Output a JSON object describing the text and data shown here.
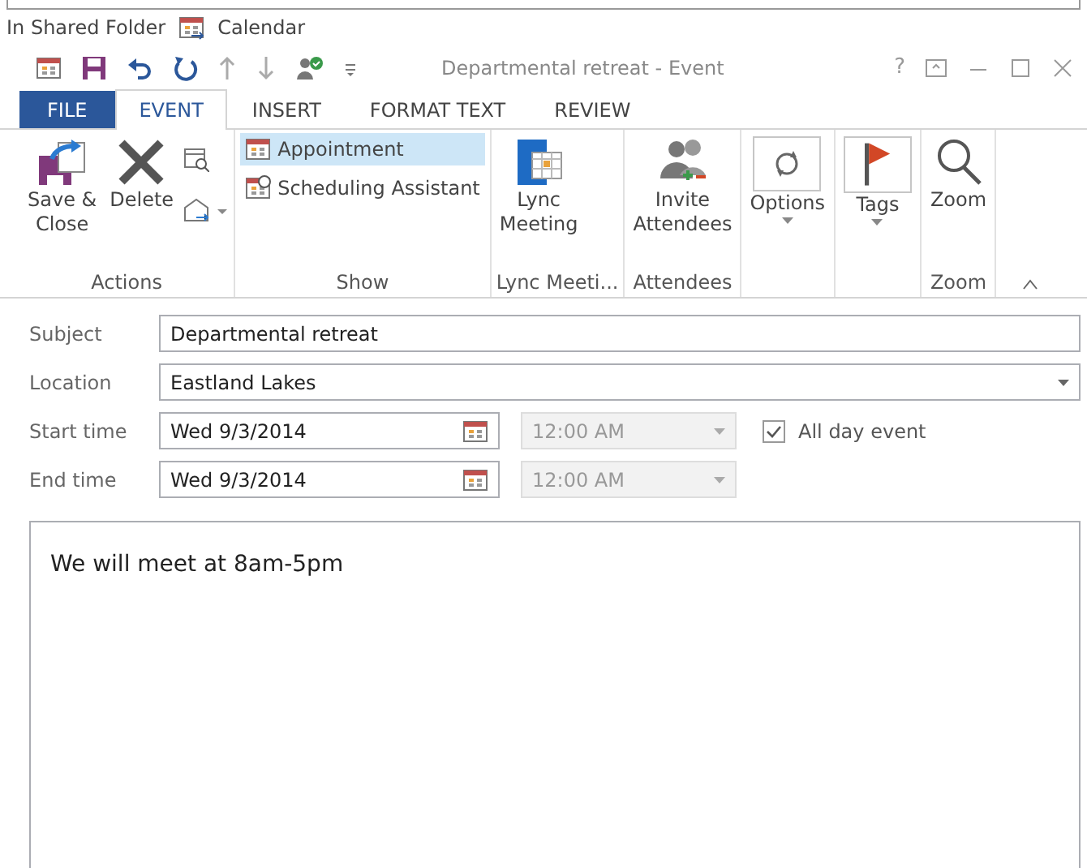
{
  "folder_bar": {
    "label": "In Shared Folder",
    "folder": "Calendar"
  },
  "title_bar": {
    "title": "Departmental retreat - Event",
    "help": "?"
  },
  "tabs": [
    {
      "label": "FILE",
      "kind": "file",
      "selected": false
    },
    {
      "label": "EVENT",
      "kind": "tab",
      "selected": true
    },
    {
      "label": "INSERT",
      "kind": "tab",
      "selected": false
    },
    {
      "label": "FORMAT TEXT",
      "kind": "tab",
      "selected": false
    },
    {
      "label": "REVIEW",
      "kind": "tab",
      "selected": false
    }
  ],
  "ribbon": {
    "groups": [
      {
        "label": "Actions",
        "items": [
          {
            "kind": "large",
            "label": "Save &\nClose"
          },
          {
            "kind": "large",
            "label": "Delete"
          },
          {
            "kind": "iconstack"
          }
        ]
      },
      {
        "label": "Show",
        "items": [
          {
            "kind": "small",
            "label": "Appointment",
            "selected": true
          },
          {
            "kind": "small",
            "label": "Scheduling Assistant",
            "selected": false
          }
        ]
      },
      {
        "label": "Lync Meeti...",
        "items": [
          {
            "kind": "large",
            "label": "Lync\nMeeting"
          }
        ]
      },
      {
        "label": "Attendees",
        "items": [
          {
            "kind": "large",
            "label": "Invite\nAttendees"
          }
        ]
      },
      {
        "items": [
          {
            "kind": "large",
            "label": "Options",
            "has_menu": true
          }
        ]
      },
      {
        "items": [
          {
            "kind": "large",
            "label": "Tags",
            "has_menu": true
          }
        ]
      },
      {
        "label": "Zoom",
        "items": [
          {
            "kind": "large",
            "label": "Zoom"
          }
        ]
      }
    ]
  },
  "form": {
    "subject": {
      "label": "Subject",
      "value": "Departmental retreat"
    },
    "location": {
      "label": "Location",
      "value": "Eastland Lakes"
    },
    "start": {
      "label": "Start time",
      "date": "Wed 9/3/2014",
      "time": "12:00 AM",
      "time_disabled": true
    },
    "end": {
      "label": "End time",
      "date": "Wed 9/3/2014",
      "time": "12:00 AM",
      "time_disabled": true
    },
    "all_day": {
      "label": "All day event",
      "checked": true
    }
  },
  "body": {
    "text": "We will meet at 8am-5pm"
  }
}
